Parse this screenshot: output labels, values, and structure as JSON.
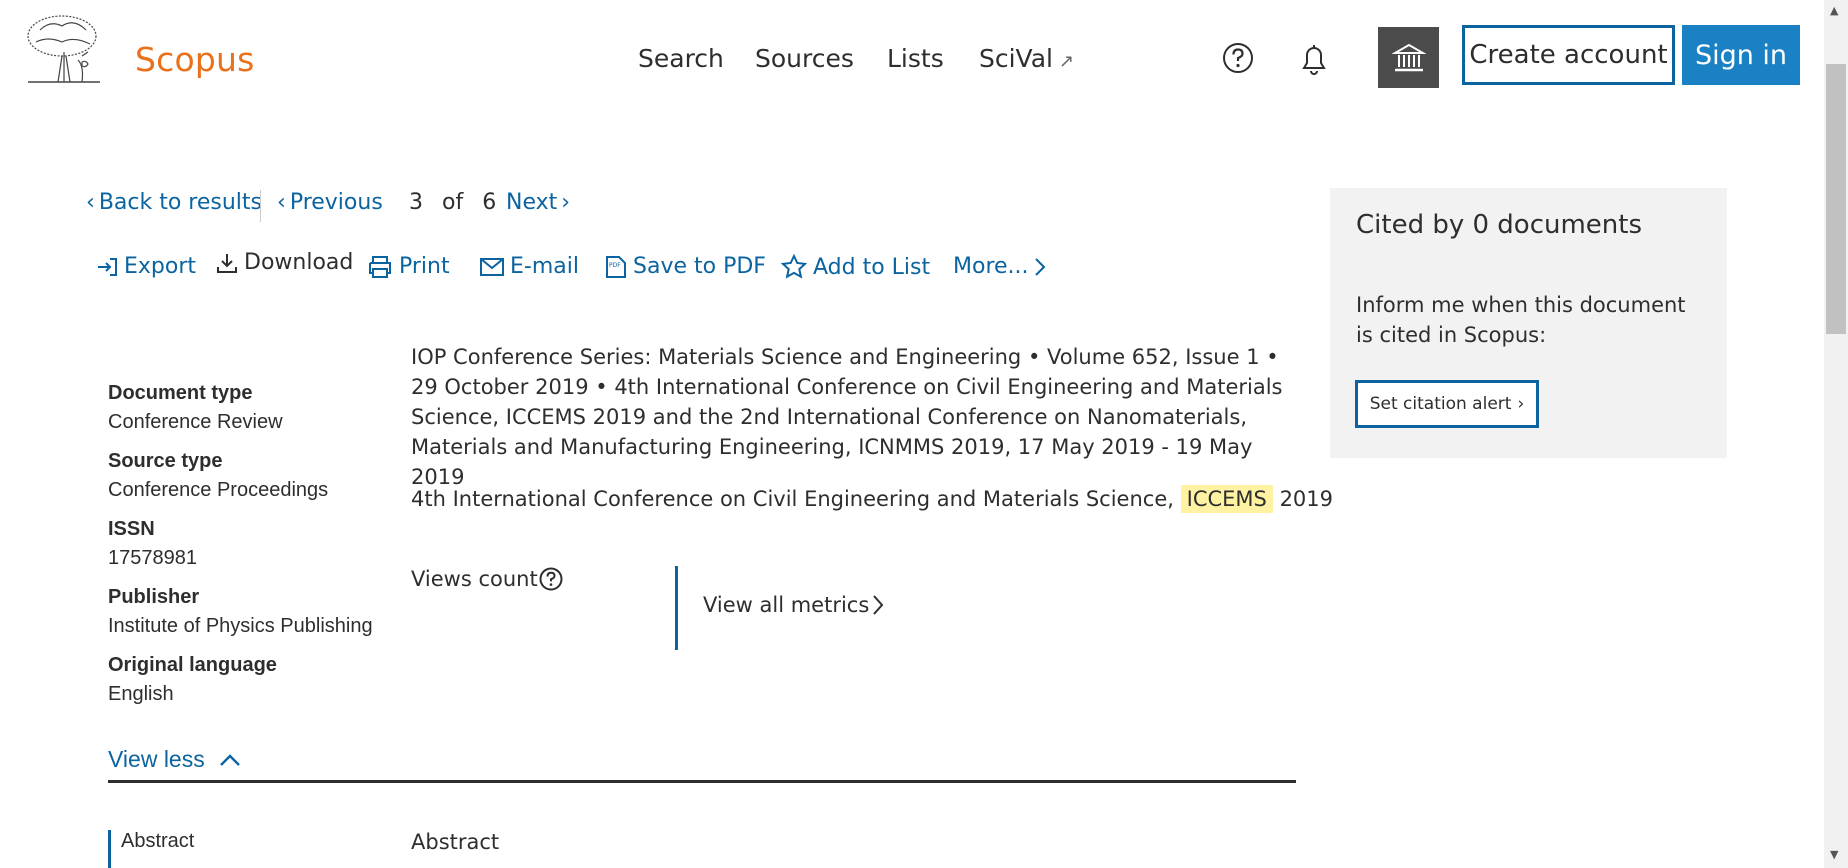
{
  "header": {
    "brand": "Scopus",
    "nav": [
      "Search",
      "Sources",
      "Lists",
      "SciVal"
    ],
    "scival_ext": "↗",
    "create_account": "Create account",
    "sign_in": "Sign in"
  },
  "results_nav": {
    "back": "Back to results",
    "previous": "Previous",
    "current": "3",
    "of": "of",
    "total": "6",
    "next": "Next"
  },
  "toolbar": {
    "export": "Export",
    "download": "Download",
    "print": "Print",
    "email": "E-mail",
    "save_pdf": "Save to PDF",
    "add_list": "Add to List",
    "more": "More..."
  },
  "meta": {
    "doctype_label": "Document type",
    "doctype_value": "Conference Review",
    "sourcetype_label": "Source type",
    "sourcetype_value": "Conference Proceedings",
    "issn_label": "ISSN",
    "issn_value": "17578981",
    "publisher_label": "Publisher",
    "publisher_value": "Institute of Physics Publishing",
    "lang_label": "Original language",
    "lang_value": "English",
    "view_less": "View less"
  },
  "source": {
    "journal": "IOP Conference Series: Materials Science and Engineering",
    "volume": "Volume 652, Issue 1",
    "date": "29 October 2019",
    "conference": "4th International Conference on Civil Engineering and Materials Science, ICCEMS 2019 and the 2nd International Conference on Nanomaterials, Materials and Manufacturing Engineering, ICNMMS 2019, 17 May 2019 - 19 May 2019"
  },
  "conf_line": {
    "prefix": "4th International Conference on Civil Engineering and Materials Science,",
    "highlight": "ICCEMS",
    "suffix": "2019"
  },
  "metrics": {
    "views_count": "Views count",
    "view_all": "View all metrics"
  },
  "abstract": {
    "side_label": "Abstract",
    "heading": "Abstract"
  },
  "cited": {
    "title": "Cited by 0 documents",
    "text": "Inform me when this document is cited in Scopus:",
    "button": "Set citation alert"
  }
}
